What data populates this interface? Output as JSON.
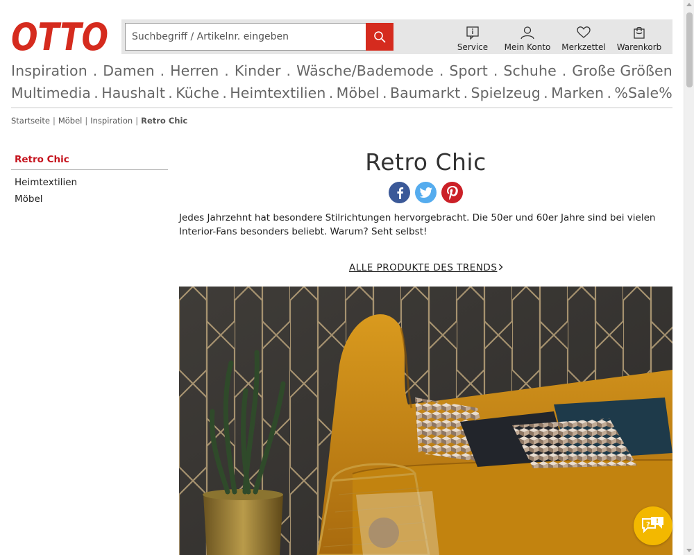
{
  "brand": {
    "logo_text": "OTTO",
    "accent_color": "#d52b1e",
    "link_active_color": "#c5131d"
  },
  "search": {
    "placeholder": "Suchbegriff / Artikelnr. eingeben",
    "value": "",
    "button_icon": "magnifier-icon"
  },
  "header_links": [
    {
      "label": "Service",
      "icon": "info-icon"
    },
    {
      "label": "Mein Konto",
      "icon": "user-icon"
    },
    {
      "label": "Merkzettel",
      "icon": "heart-icon"
    },
    {
      "label": "Warenkorb",
      "icon": "shopping-bag-icon"
    }
  ],
  "nav": {
    "row1": [
      "Inspiration",
      "Damen",
      "Herren",
      "Kinder",
      "Wäsche/Bademode",
      "Sport",
      "Schuhe",
      "Große Größen"
    ],
    "row2": [
      "Multimedia",
      "Haushalt",
      "Küche",
      "Heimtextilien",
      "Möbel",
      "Baumarkt",
      "Spielzeug",
      "Marken",
      "%Sale%"
    ],
    "separator": "."
  },
  "breadcrumb": {
    "items": [
      "Startseite",
      "Möbel",
      "Inspiration"
    ],
    "current": "Retro Chic",
    "separator": "|"
  },
  "sidebar": {
    "active": "Retro Chic",
    "items": [
      "Heimtextilien",
      "Möbel"
    ]
  },
  "main": {
    "title": "Retro Chic",
    "share": [
      {
        "network": "Facebook",
        "color": "#3b5998",
        "icon": "facebook-icon"
      },
      {
        "network": "Twitter",
        "color": "#55acee",
        "icon": "twitter-icon"
      },
      {
        "network": "Pinterest",
        "color": "#cb2027",
        "icon": "pinterest-icon"
      }
    ],
    "intro": "Jedes Jahrzehnt hat besondere Stilrichtungen hervorgebracht. Die 50er und 60er Jahre sind bei vielen Interior-Fans besonders beliebt. Warum? Seht selbst!",
    "trend_link": "ALLE PRODUKTE DES TRENDS",
    "hero_image": "retro-living-room-photo"
  },
  "chat": {
    "icon": "chat-help-icon",
    "color": "#f3b800"
  }
}
